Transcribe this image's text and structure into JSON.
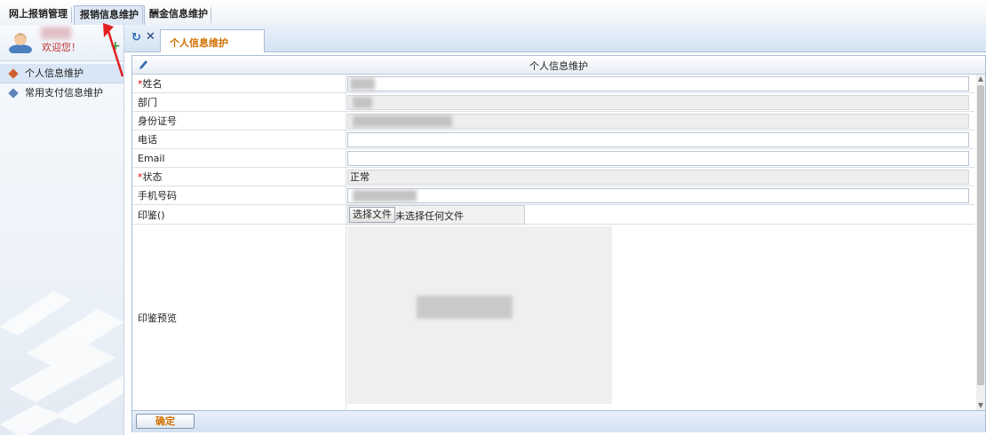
{
  "topnav": {
    "tabs": [
      {
        "label": "网上报销管理"
      },
      {
        "label": "报销信息维护"
      },
      {
        "label": "酬金信息维护"
      }
    ],
    "active_index": 1
  },
  "sidebar": {
    "welcome": "欢迎您！",
    "items": [
      {
        "label": "个人信息维护",
        "active": true
      },
      {
        "label": "常用支付信息维护",
        "active": false
      }
    ]
  },
  "tabs": {
    "current": "个人信息维护"
  },
  "panel": {
    "title": "个人信息维护",
    "fields": [
      {
        "label": "姓名",
        "required": true,
        "value": ""
      },
      {
        "label": "部门",
        "required": false,
        "value": ""
      },
      {
        "label": "身份证号",
        "required": false,
        "value": ""
      },
      {
        "label": "电话",
        "required": false,
        "value": ""
      },
      {
        "label": "Email",
        "required": false,
        "value": ""
      },
      {
        "label": "状态",
        "required": true,
        "value": "正常"
      },
      {
        "label": "手机号码",
        "required": false,
        "value": ""
      },
      {
        "label": "印鉴()",
        "required": false,
        "value": ""
      },
      {
        "label": "印鉴预览",
        "required": false,
        "value": ""
      }
    ],
    "file_button": "选择文件",
    "file_status": "未选择任何文件",
    "submit": "确定"
  },
  "colors": {
    "accent_orange": "#d07000",
    "required_red": "#dd0000",
    "header_blue": "#d5e3f3",
    "annotation_red": "#e02020"
  }
}
